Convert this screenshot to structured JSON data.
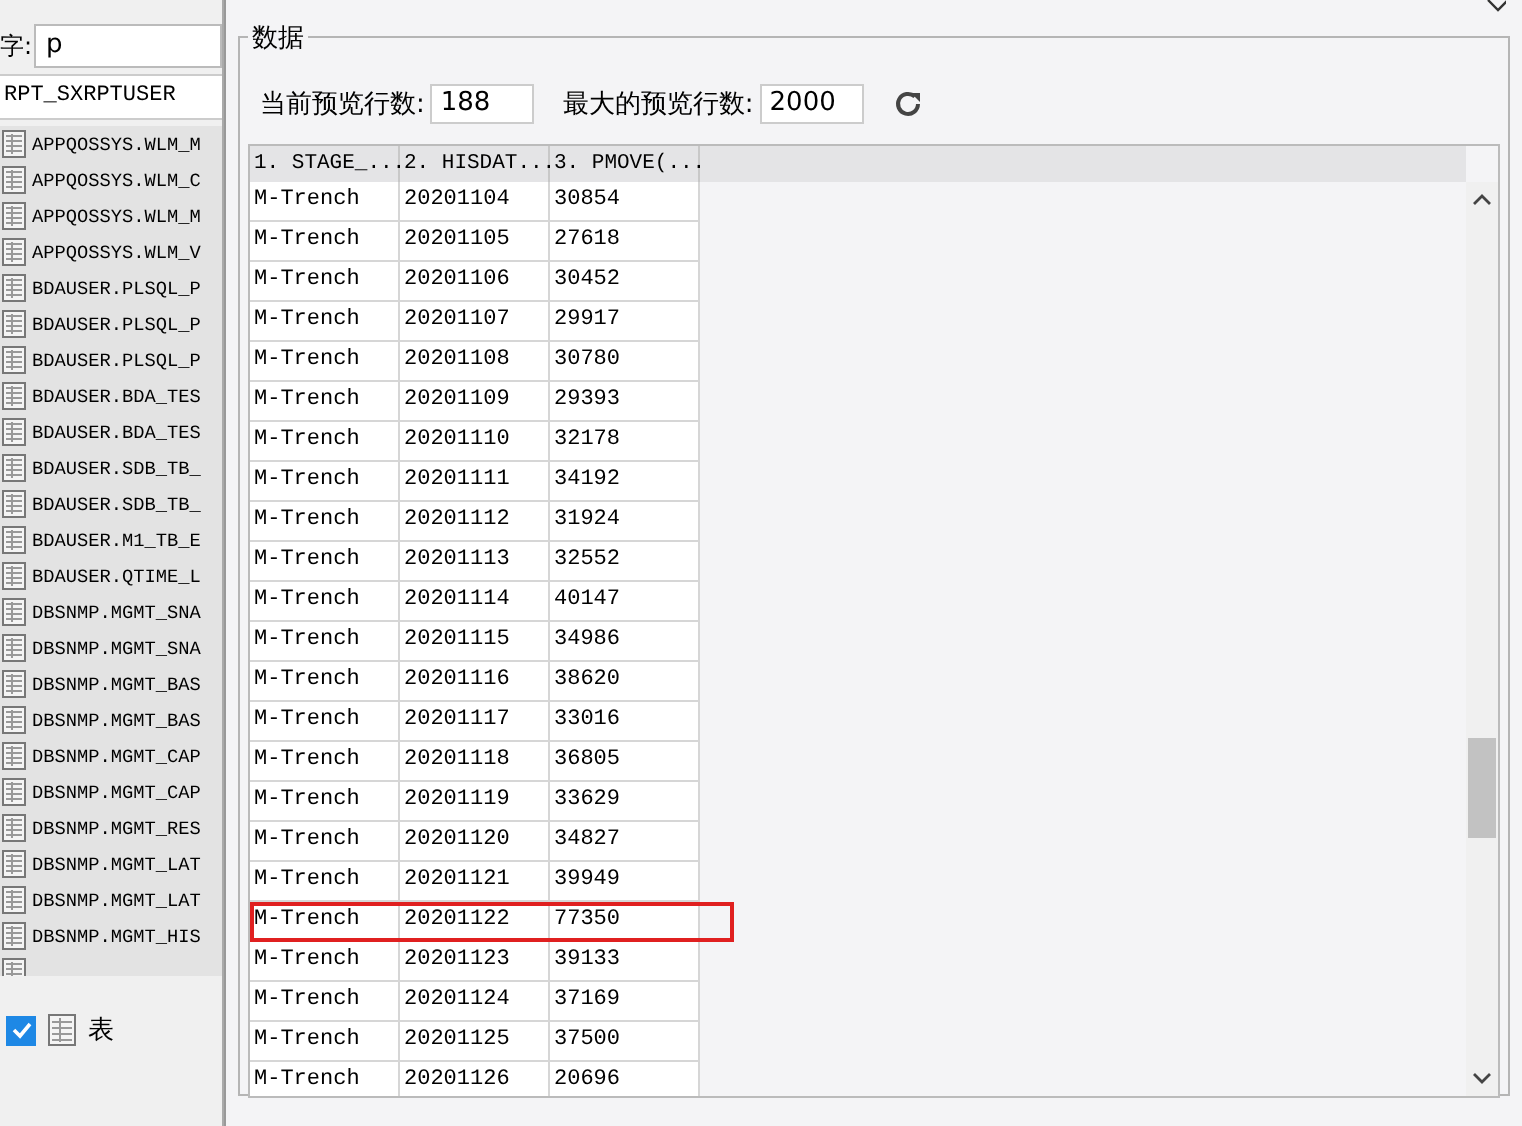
{
  "left_panel": {
    "name_label": "字:",
    "name_value": "p",
    "schema_value": "RPT_SXRPTUSER",
    "tables": [
      "APPQOSSYS.WLM_M",
      "APPQOSSYS.WLM_C",
      "APPQOSSYS.WLM_M",
      "APPQOSSYS.WLM_V",
      "BDAUSER.PLSQL_P",
      "BDAUSER.PLSQL_P",
      "BDAUSER.PLSQL_P",
      "BDAUSER.BDA_TES",
      "BDAUSER.BDA_TES",
      "BDAUSER.SDB_TB_",
      "BDAUSER.SDB_TB_",
      "BDAUSER.M1_TB_E",
      "BDAUSER.QTIME_L",
      "DBSNMP.MGMT_SNA",
      "DBSNMP.MGMT_SNA",
      "DBSNMP.MGMT_BAS",
      "DBSNMP.MGMT_BAS",
      "DBSNMP.MGMT_CAP",
      "DBSNMP.MGMT_CAP",
      "DBSNMP.MGMT_RES",
      "DBSNMP.MGMT_LAT",
      "DBSNMP.MGMT_LAT",
      "DBSNMP.MGMT_HIS"
    ],
    "filter": {
      "checked": true,
      "label": "表"
    }
  },
  "dialog": {
    "group_title": "数据",
    "current_rows_label": "当前预览行数:",
    "current_rows_value": "188",
    "max_rows_label": "最大的预览行数:",
    "max_rows_value": "2000",
    "table": {
      "columns": [
        "1. STAGE_...",
        "2. HISDAT...",
        "3. PMOVE(..."
      ],
      "rows": [
        {
          "cells": [
            "M-Trench",
            "20201104",
            "30854"
          ],
          "selected": false
        },
        {
          "cells": [
            "M-Trench",
            "20201105",
            "27618"
          ],
          "selected": false
        },
        {
          "cells": [
            "M-Trench",
            "20201106",
            "30452"
          ],
          "selected": false
        },
        {
          "cells": [
            "M-Trench",
            "20201107",
            "29917"
          ],
          "selected": false
        },
        {
          "cells": [
            "M-Trench",
            "20201108",
            "30780"
          ],
          "selected": false
        },
        {
          "cells": [
            "M-Trench",
            "20201109",
            "29393"
          ],
          "selected": false
        },
        {
          "cells": [
            "M-Trench",
            "20201110",
            "32178"
          ],
          "selected": false
        },
        {
          "cells": [
            "M-Trench",
            "20201111",
            "34192"
          ],
          "selected": false
        },
        {
          "cells": [
            "M-Trench",
            "20201112",
            "31924"
          ],
          "selected": false
        },
        {
          "cells": [
            "M-Trench",
            "20201113",
            "32552"
          ],
          "selected": false
        },
        {
          "cells": [
            "M-Trench",
            "20201114",
            "40147"
          ],
          "selected": false
        },
        {
          "cells": [
            "M-Trench",
            "20201115",
            "34986"
          ],
          "selected": false
        },
        {
          "cells": [
            "M-Trench",
            "20201116",
            "38620"
          ],
          "selected": false
        },
        {
          "cells": [
            "M-Trench",
            "20201117",
            "33016"
          ],
          "selected": false
        },
        {
          "cells": [
            "M-Trench",
            "20201118",
            "36805"
          ],
          "selected": false
        },
        {
          "cells": [
            "M-Trench",
            "20201119",
            "33629"
          ],
          "selected": false
        },
        {
          "cells": [
            "M-Trench",
            "20201120",
            "34827"
          ],
          "selected": false
        },
        {
          "cells": [
            "M-Trench",
            "20201121",
            "39949"
          ],
          "selected": false
        },
        {
          "cells": [
            "M-Trench",
            "20201122",
            "77350"
          ],
          "selected": true
        },
        {
          "cells": [
            "M-Trench",
            "20201123",
            "39133"
          ],
          "selected": false
        },
        {
          "cells": [
            "M-Trench",
            "20201124",
            "37169"
          ],
          "selected": false
        },
        {
          "cells": [
            "M-Trench",
            "20201125",
            "37500"
          ],
          "selected": false
        },
        {
          "cells": [
            "M-Trench",
            "20201126",
            "20696"
          ],
          "selected": false
        }
      ]
    }
  }
}
